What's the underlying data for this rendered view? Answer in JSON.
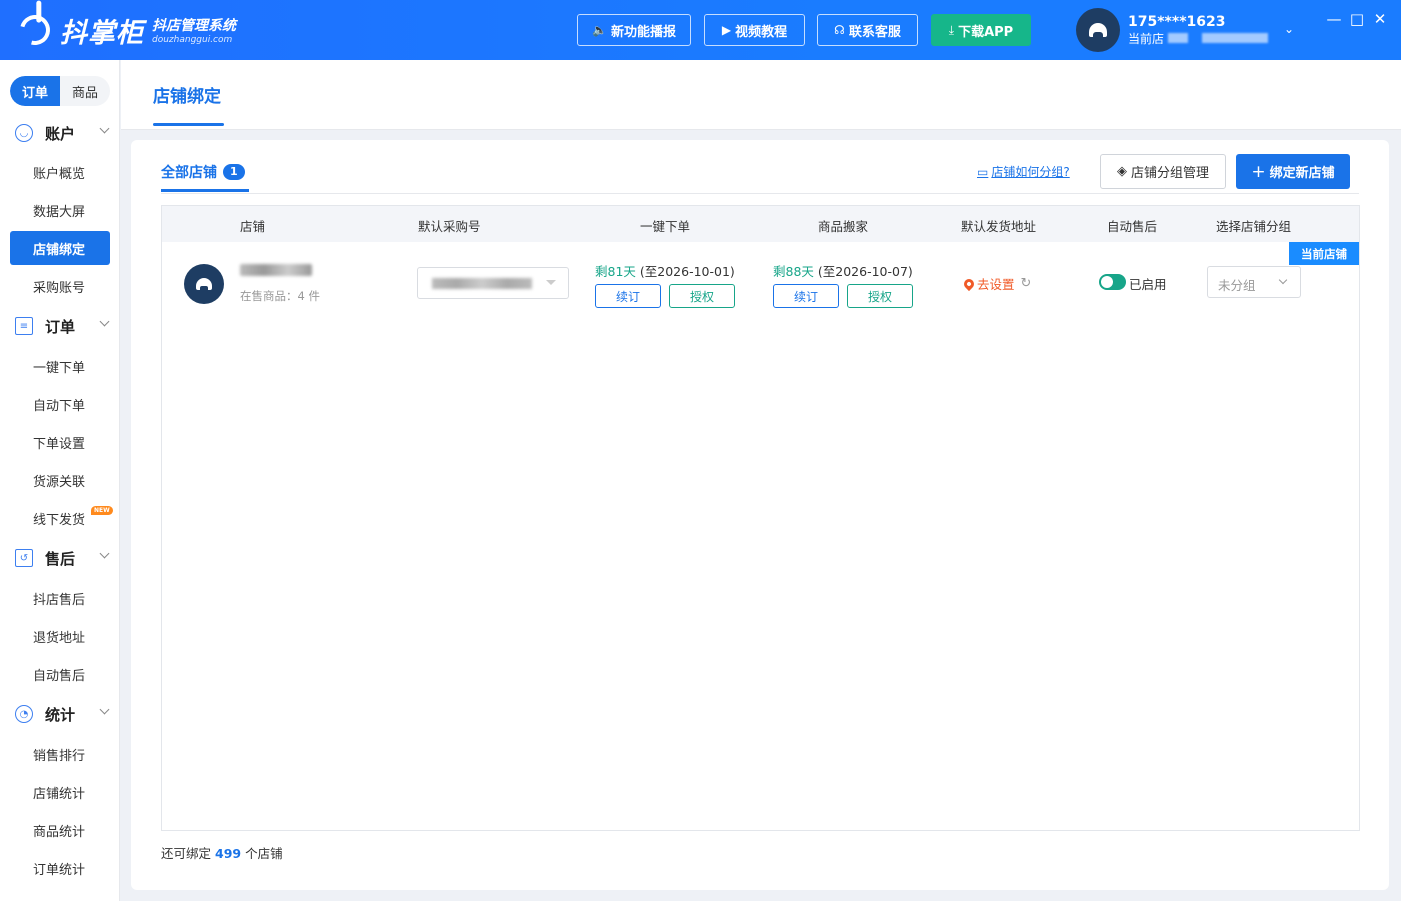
{
  "app": {
    "logo_name": "抖掌柜",
    "logo_sub": "抖店管理系统",
    "logo_url": "douzhanggui.com"
  },
  "header_buttons": [
    {
      "label": "新功能播报",
      "icon": "speaker-icon"
    },
    {
      "label": "视频教程",
      "icon": "video-icon"
    },
    {
      "label": "联系客服",
      "icon": "headset-icon"
    },
    {
      "label": "下载APP",
      "icon": "download-icon"
    }
  ],
  "user": {
    "phone": "175****1623",
    "current_label": "当前店"
  },
  "sidebar": {
    "segments": [
      "订单",
      "商品"
    ],
    "groups": [
      {
        "title": "账户",
        "items": [
          "账户概览",
          "数据大屏",
          "店铺绑定",
          "采购账号"
        ]
      },
      {
        "title": "订单",
        "items": [
          "一键下单",
          "自动下单",
          "下单设置",
          "货源关联",
          "线下发货"
        ]
      },
      {
        "title": "售后",
        "items": [
          "抖店售后",
          "退货地址",
          "自动售后"
        ]
      },
      {
        "title": "统计",
        "items": [
          "销售排行",
          "店铺统计",
          "商品统计",
          "订单统计"
        ]
      }
    ],
    "new_tag": "NEW"
  },
  "page": {
    "title": "店铺绑定"
  },
  "toolbar": {
    "tab_all": "全部店铺",
    "tab_count": "1",
    "how_link": "店铺如何分组?",
    "group_manage": "店铺分组管理",
    "bind_new": "绑定新店铺"
  },
  "table": {
    "columns": [
      "店铺",
      "默认采购号",
      "一键下单",
      "商品搬家",
      "默认发货地址",
      "自动售后",
      "选择店铺分组"
    ],
    "rows": [
      {
        "goods": "在售商品：4 件",
        "one_click": {
          "days": "剩81天",
          "until": "(至2026-10-01)",
          "renew": "续订",
          "auth": "授权"
        },
        "move": {
          "days": "剩88天",
          "until": "(至2026-10-07)",
          "renew": "续订",
          "auth": "授权"
        },
        "address": "去设置",
        "auto_after_sale": "已启用",
        "group": "未分组",
        "badge": "当前店铺"
      }
    ]
  },
  "footer": {
    "prefix": "还可绑定",
    "count": "499",
    "suffix": "个店铺"
  },
  "colors": {
    "primary": "#1a73e8",
    "header": "#1a7cff",
    "green": "#17a589",
    "orange": "#f05a28"
  }
}
